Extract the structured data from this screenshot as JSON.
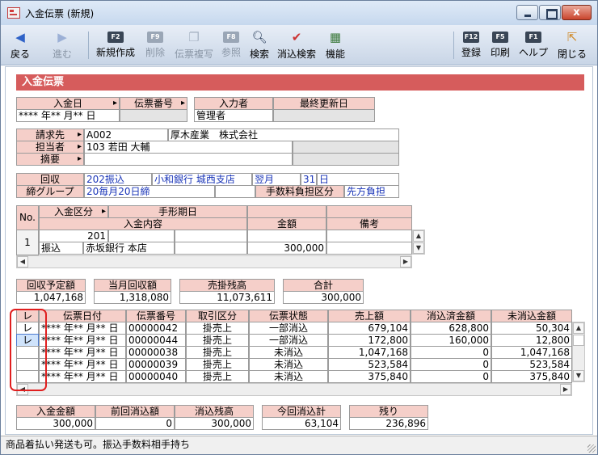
{
  "window": {
    "title": "入金伝票 (新規)",
    "close_glyph": "x"
  },
  "toolbar": {
    "back": "戻る",
    "forward": "進む",
    "new": "新規作成",
    "delete": "削除",
    "copy": "伝票複写",
    "ref": "参照",
    "search": "検索",
    "clear_search": "消込検索",
    "func": "機能",
    "register": "登録",
    "print": "印刷",
    "help": "ヘルプ",
    "close": "閉じる",
    "fkeys": {
      "new": "F2",
      "delete": "F9",
      "ref": "F8",
      "register": "F12",
      "print": "F5",
      "help": "F1"
    }
  },
  "section_title": "入金伝票",
  "header": {
    "date_label": "入金日",
    "date_value": "**** 年** 月** 日",
    "slip_no_label": "伝票番号",
    "slip_no_value": "",
    "entered_by_label": "入力者",
    "entered_by_value": "管理者",
    "last_updated_label": "最終更新日",
    "last_updated_value": ""
  },
  "customer": {
    "billing_label": "請求先",
    "billing_code": "A002",
    "billing_name": "厚木産業　株式会社",
    "rep_label": "担当者",
    "rep_code": "103",
    "rep_name": "若田 大輔",
    "summary_label": "摘要"
  },
  "collection": {
    "collect_label": "回収",
    "collect_code": "202",
    "collect_method": "振込",
    "collect_bank": "小和銀行 城西支店",
    "collect_month": "翌月",
    "collect_day": "31",
    "collect_day_unit": "日",
    "close_group_label": "締グループ",
    "close_group_code": "20",
    "close_group_value": "毎月20日締",
    "fee_label": "手数料負担区分",
    "fee_value": "先方負担"
  },
  "detail": {
    "no_label": "No.",
    "kind_label": "入金区分",
    "bill_date_label": "手形期日",
    "content_label": "入金内容",
    "amount_label": "金額",
    "note_label": "備考",
    "row": {
      "no": "1",
      "code": "201",
      "method": "振込",
      "bank": "赤坂銀行 本店",
      "amount": "300,000"
    }
  },
  "summary": {
    "planned_label": "回収予定額",
    "planned_value": "1,047,168",
    "month_label": "当月回収額",
    "month_value": "1,318,080",
    "receivable_label": "売掛残高",
    "receivable_value": "11,073,611",
    "total_label": "合計",
    "total_value": "300,000"
  },
  "clearing": {
    "columns": [
      "レ",
      "伝票日付",
      "伝票番号",
      "取引区分",
      "伝票状態",
      "売上額",
      "消込済金額",
      "未消込金額"
    ],
    "rows": [
      {
        "check": "レ",
        "date": "**** 年** 月** 日",
        "slip": "00000042",
        "type": "掛売上",
        "status": "一部消込",
        "sales": "679,104",
        "cleared": "628,800",
        "remaining": "50,304"
      },
      {
        "check": "レ",
        "date": "**** 年** 月** 日",
        "slip": "00000044",
        "type": "掛売上",
        "status": "一部消込",
        "sales": "172,800",
        "cleared": "160,000",
        "remaining": "12,800"
      },
      {
        "check": "",
        "date": "**** 年** 月** 日",
        "slip": "00000038",
        "type": "掛売上",
        "status": "未消込",
        "sales": "1,047,168",
        "cleared": "0",
        "remaining": "1,047,168"
      },
      {
        "check": "",
        "date": "**** 年** 月** 日",
        "slip": "00000039",
        "type": "掛売上",
        "status": "未消込",
        "sales": "523,584",
        "cleared": "0",
        "remaining": "523,584"
      },
      {
        "check": "",
        "date": "**** 年** 月** 日",
        "slip": "00000040",
        "type": "掛売上",
        "status": "未消込",
        "sales": "375,840",
        "cleared": "0",
        "remaining": "375,840"
      }
    ]
  },
  "footer": {
    "paid_label": "入金金額",
    "paid_value": "300,000",
    "prev_label": "前回消込額",
    "prev_value": "0",
    "bal_label": "消込残高",
    "bal_value": "300,000",
    "today_label": "今回消込計",
    "today_value": "63,104",
    "rest_label": "残り",
    "rest_value": "236,896"
  },
  "status_text": "商品着払い発送も可。振込手数料相手持ち"
}
